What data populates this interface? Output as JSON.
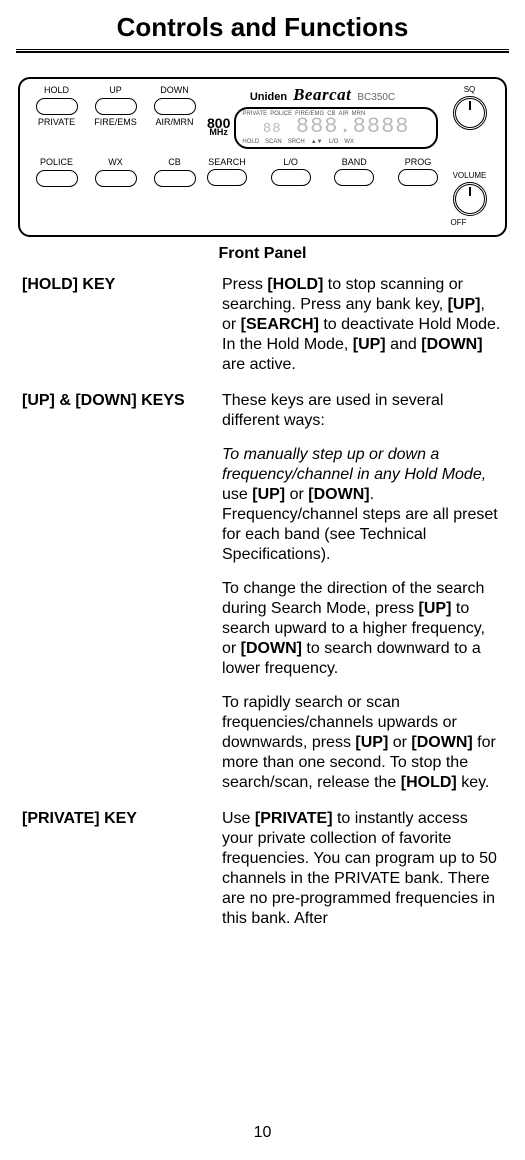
{
  "page_title": "Controls and Functions",
  "panel": {
    "buttons": [
      {
        "top": "HOLD",
        "bottom": "PRIVATE"
      },
      {
        "top": "UP",
        "bottom": "FIRE/EMS"
      },
      {
        "top": "DOWN",
        "bottom": "AIR/MRN"
      },
      {
        "top": "POLICE",
        "bottom": ""
      },
      {
        "top": "WX",
        "bottom": ""
      },
      {
        "top": "CB",
        "bottom": ""
      }
    ],
    "brand": "Uniden",
    "brand_logo": "Bearcat",
    "model": "BC350C",
    "mhz_big": "800",
    "mhz_small": "MHz",
    "lcd_services": [
      "PRIVATE",
      "POLICE",
      "FIRE/EMG",
      "CB",
      "AIR",
      "MRN"
    ],
    "lcd_digits_ch": "88",
    "lcd_digits_main": "888.8888",
    "lcd_status": [
      "HOLD",
      "SCAN",
      "SRCH",
      "▲▼",
      "L/O",
      "WX"
    ],
    "center_buttons": [
      "SEARCH",
      "L/O",
      "BAND",
      "PROG"
    ],
    "knob_sq": "SQ",
    "knob_vol": "VOLUME",
    "knob_off": "OFF"
  },
  "panel_caption": "Front Panel",
  "defs": [
    {
      "term": "[HOLD] KEY",
      "paras": [
        {
          "html": "Press <b>[HOLD]</b> to stop scanning or searching. Press any bank key, <b>[UP]</b>, or <b>[SEARCH]</b> to deactivate Hold Mode. In the Hold Mode, <b>[UP]</b> and <b>[DOWN]</b> are active."
        }
      ]
    },
    {
      "term": "[UP] & [DOWN] KEYS",
      "paras": [
        {
          "html": "These keys are used in several different ways:"
        },
        {
          "html": "<span class=\"italic\">To manually step up or down a frequency/channel in any Hold Mode,</span> use <b>[UP]</b> or <b>[DOWN]</b>. Frequency/channel steps are all preset for each band (see Technical Specifications)."
        },
        {
          "html": "To change the direction of the search during Search Mode, press <b>[UP]</b> to search upward to a higher frequency, or <b>[DOWN]</b> to search downward to a lower frequency."
        },
        {
          "html": "To rapidly search or scan frequencies/channels upwards or downwards, press <b>[UP]</b> or <b>[DOWN]</b> for more than one second. To stop the search/scan, release the <b>[HOLD]</b> key."
        }
      ]
    },
    {
      "term": "[PRIVATE] KEY",
      "paras": [
        {
          "html": "Use <b>[PRIVATE]</b> to instantly access your private collection of favorite frequencies. You can program up to 50 channels in the PRIVATE bank. There are no pre-programmed frequencies in this bank. After"
        }
      ]
    }
  ],
  "page_number": "10"
}
